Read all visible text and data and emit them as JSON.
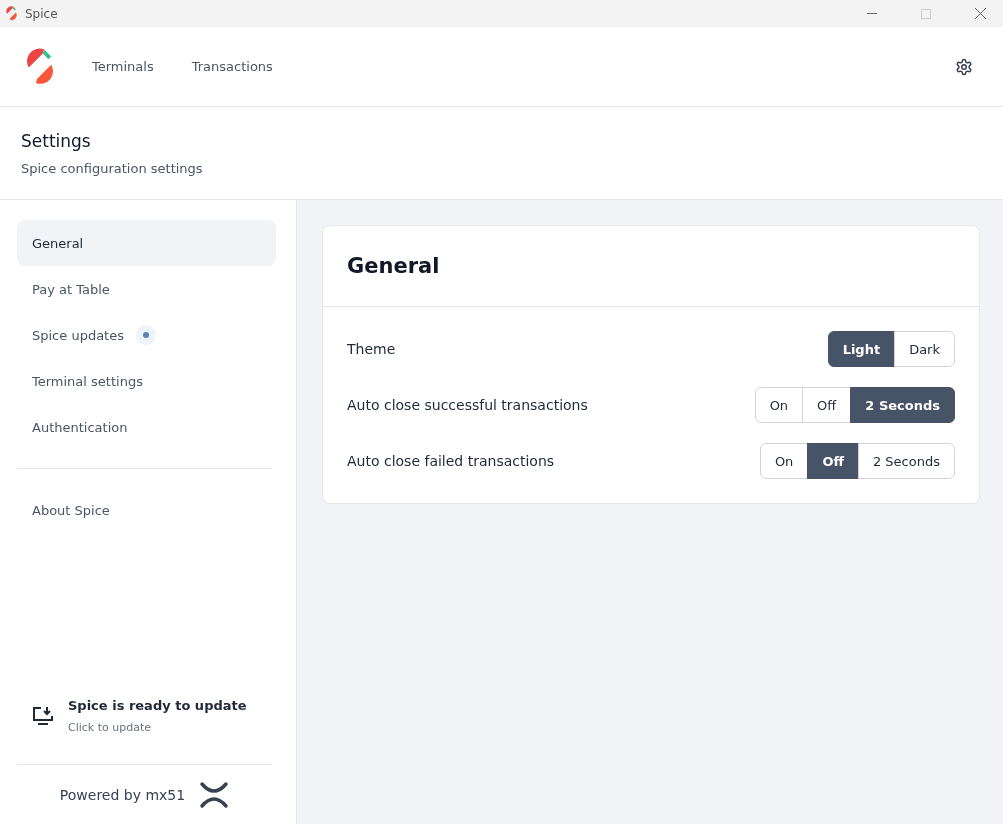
{
  "window": {
    "title": "Spice"
  },
  "nav": {
    "links": [
      "Terminals",
      "Transactions"
    ]
  },
  "page_header": {
    "title": "Settings",
    "subtitle": "Spice configuration settings"
  },
  "sidebar": {
    "items": [
      {
        "label": "General",
        "selected": true,
        "dot": false
      },
      {
        "label": "Pay at Table",
        "selected": false,
        "dot": false
      },
      {
        "label": "Spice updates",
        "selected": false,
        "dot": true
      },
      {
        "label": "Terminal settings",
        "selected": false,
        "dot": false
      },
      {
        "label": "Authentication",
        "selected": false,
        "dot": false
      }
    ],
    "secondary_items": [
      {
        "label": "About Spice",
        "selected": false,
        "dot": false
      }
    ],
    "update": {
      "title": "Spice is ready to update",
      "subtitle": "Click to update"
    },
    "footer": "Powered by mx51"
  },
  "panel": {
    "title": "General",
    "settings": [
      {
        "label": "Theme",
        "options": [
          {
            "label": "Light",
            "selected": true
          },
          {
            "label": "Dark",
            "selected": false
          }
        ]
      },
      {
        "label": "Auto close successful transactions",
        "options": [
          {
            "label": "On",
            "selected": false
          },
          {
            "label": "Off",
            "selected": false
          },
          {
            "label": "2 Seconds",
            "selected": true
          }
        ]
      },
      {
        "label": "Auto close failed transactions",
        "options": [
          {
            "label": "On",
            "selected": false
          },
          {
            "label": "Off",
            "selected": true
          },
          {
            "label": "2 Seconds",
            "selected": false
          }
        ]
      }
    ]
  }
}
